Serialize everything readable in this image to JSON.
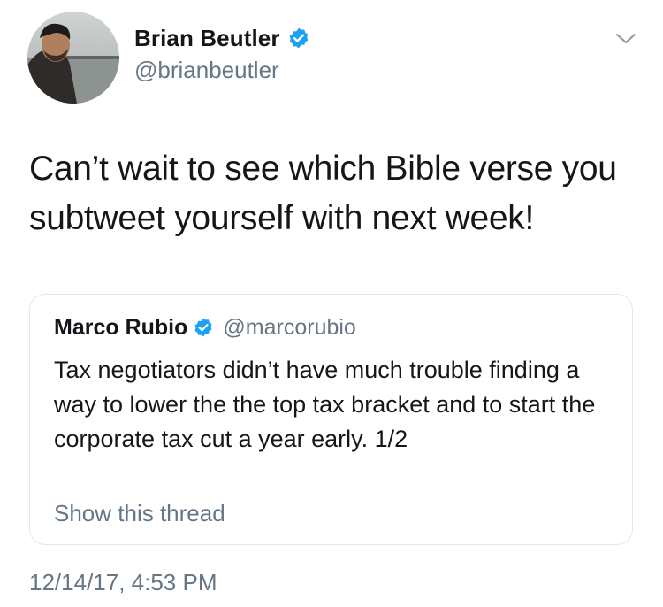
{
  "author": {
    "display_name": "Brian Beutler",
    "handle": "@brianbeutler",
    "avatar_icon": "profile-photo"
  },
  "tweet": {
    "text": "Can’t wait to see which Bible verse you subtweet yourself with next week!",
    "timestamp": "12/14/17, 4:53 PM"
  },
  "quoted_tweet": {
    "display_name": "Marco Rubio",
    "handle": "@marcorubio",
    "text": "Tax negotiators didn’t have much trouble finding a way to lower the the top tax bracket and to start the corporate tax cut a year early. 1/2",
    "thread_link": "Show this thread"
  },
  "icons": {
    "verified": "verified-badge-icon",
    "menu": "chevron-down-icon"
  },
  "colors": {
    "verified_blue": "#1da1f2",
    "secondary_text": "#657786",
    "primary_text": "#14171a",
    "border": "#e1e8ed"
  }
}
